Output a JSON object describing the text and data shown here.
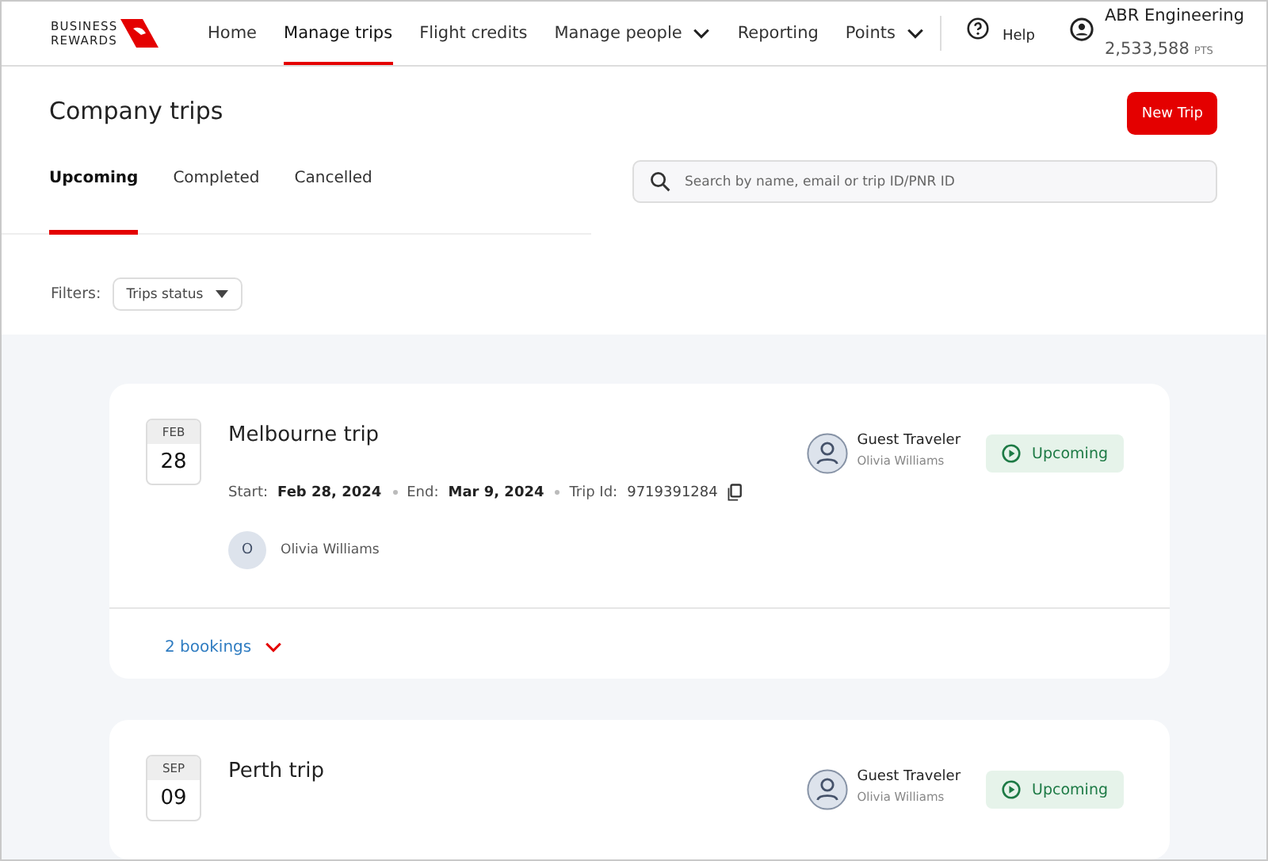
{
  "header": {
    "logo": [
      "BUSINESS",
      "REWARDS"
    ],
    "nav": [
      {
        "label": "Home",
        "selected": false,
        "dropdown": false
      },
      {
        "label": "Manage trips",
        "selected": true,
        "dropdown": false
      },
      {
        "label": "Flight credits",
        "selected": false,
        "dropdown": false
      },
      {
        "label": "Manage people",
        "selected": false,
        "dropdown": true
      },
      {
        "label": "Reporting",
        "selected": false,
        "dropdown": false
      },
      {
        "label": "Points",
        "selected": false,
        "dropdown": true
      }
    ],
    "help": "Help",
    "account": {
      "name": "ABR Engineering",
      "points": "2,533,588",
      "unit": "PTS"
    }
  },
  "page": {
    "title": "Company trips",
    "new_button": "New Trip",
    "tabs": [
      {
        "label": "Upcoming",
        "selected": true
      },
      {
        "label": "Completed",
        "selected": false
      },
      {
        "label": "Cancelled",
        "selected": false
      }
    ],
    "search": {
      "placeholder": "Search by name, email or trip ID/PNR ID"
    },
    "filters": {
      "label": "Filters:",
      "dropdown": "Trips status"
    }
  },
  "trips": [
    {
      "month": "FEB",
      "day": "28",
      "title": "Melbourne trip",
      "start_label": "Start:",
      "start": "Feb 28, 2024",
      "end_label": "End:",
      "end": "Mar 9, 2024",
      "id_label": "Trip Id:",
      "trip_id": "9719391284",
      "travelers": [
        {
          "initial": "O",
          "name": "Olivia Williams"
        }
      ],
      "guest_label": "Guest Traveler",
      "guest_name": "Olivia Williams",
      "status": "Upcoming",
      "bookings": "2 bookings"
    },
    {
      "month": "SEP",
      "day": "09",
      "title": "Perth trip",
      "guest_label": "Guest Traveler",
      "guest_name": "Olivia Williams",
      "status": "Upcoming"
    }
  ]
}
